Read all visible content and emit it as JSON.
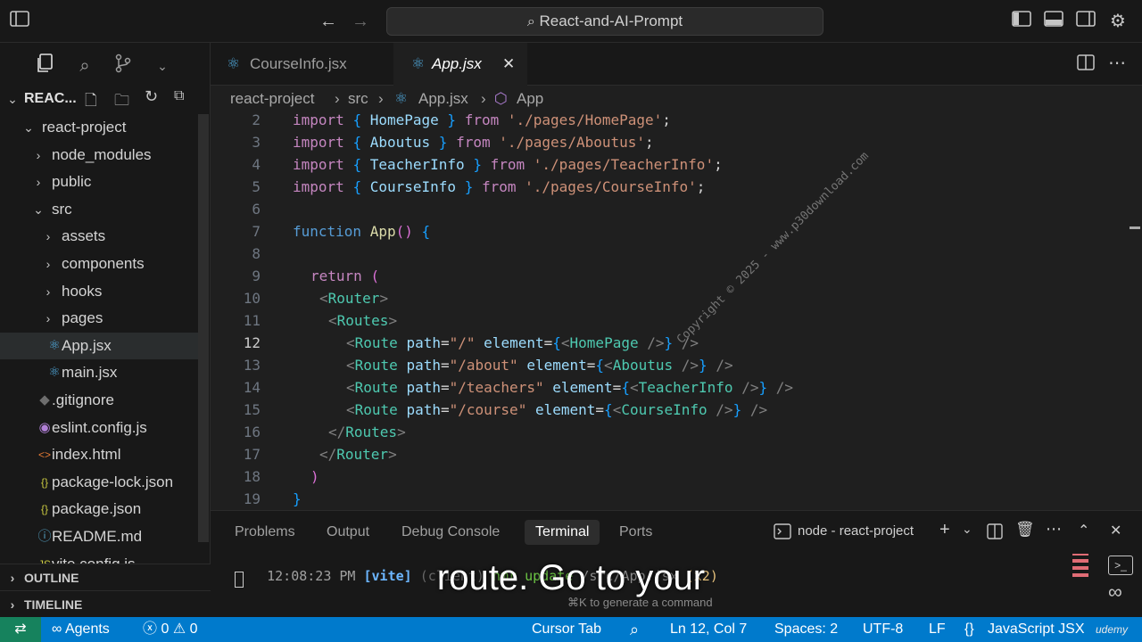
{
  "titlebar": {
    "search_text": "React-and-AI-Prompt"
  },
  "sidebar": {
    "explorer_title": "REAC...",
    "items": [
      {
        "label": "react-project",
        "type": "folder-open",
        "depth": 0
      },
      {
        "label": "node_modules",
        "type": "folder",
        "depth": 1
      },
      {
        "label": "public",
        "type": "folder",
        "depth": 1
      },
      {
        "label": "src",
        "type": "folder-open",
        "depth": 1
      },
      {
        "label": "assets",
        "type": "folder",
        "depth": 2
      },
      {
        "label": "components",
        "type": "folder",
        "depth": 2
      },
      {
        "label": "hooks",
        "type": "folder",
        "depth": 2
      },
      {
        "label": "pages",
        "type": "folder",
        "depth": 2
      },
      {
        "label": "App.jsx",
        "type": "react",
        "depth": 2
      },
      {
        "label": "main.jsx",
        "type": "react",
        "depth": 2
      },
      {
        "label": ".gitignore",
        "type": "git",
        "depth": 1
      },
      {
        "label": "eslint.config.js",
        "type": "eslint",
        "depth": 1
      },
      {
        "label": "index.html",
        "type": "html",
        "depth": 1
      },
      {
        "label": "package-lock.json",
        "type": "json",
        "depth": 1
      },
      {
        "label": "package.json",
        "type": "json",
        "depth": 1
      },
      {
        "label": "README.md",
        "type": "info",
        "depth": 1
      },
      {
        "label": "vite.config.js",
        "type": "js",
        "depth": 1
      }
    ],
    "outline_label": "OUTLINE",
    "timeline_label": "TIMELINE"
  },
  "tabs": [
    {
      "label": "CourseInfo.jsx"
    },
    {
      "label": "App.jsx"
    }
  ],
  "breadcrumb": [
    "react-project",
    "src",
    "App.jsx",
    "App"
  ],
  "editor": {
    "lines": [
      {
        "n": "2",
        "text": "import { HomePage } from './pages/HomePage';"
      },
      {
        "n": "3",
        "text": "import { Aboutus } from './pages/Aboutus';"
      },
      {
        "n": "4",
        "text": "import { TeacherInfo } from './pages/TeacherInfo';"
      },
      {
        "n": "5",
        "text": "import { CourseInfo } from './pages/CourseInfo';"
      },
      {
        "n": "6",
        "text": ""
      },
      {
        "n": "7",
        "text": "function App() {"
      },
      {
        "n": "8",
        "text": ""
      },
      {
        "n": "9",
        "text": "return ("
      },
      {
        "n": "10",
        "text": "<Router>"
      },
      {
        "n": "11",
        "text": "<Routes>"
      },
      {
        "n": "12",
        "text": "<Route path=\"/\" element={<HomePage />} />"
      },
      {
        "n": "13",
        "text": "<Route path=\"/about\" element={<Aboutus />} />"
      },
      {
        "n": "14",
        "text": "<Route path=\"/teachers\" element={<TeacherInfo />} />"
      },
      {
        "n": "15",
        "text": "<Route path=\"/course\" element={<CourseInfo />} />"
      },
      {
        "n": "16",
        "text": "</Routes>"
      },
      {
        "n": "17",
        "text": "</Router>"
      },
      {
        "n": "18",
        "text": ")"
      },
      {
        "n": "19",
        "text": "}"
      }
    ],
    "watermark": "Copyright © 2025 - www.p30download.com"
  },
  "panel": {
    "tabs": [
      "Problems",
      "Output",
      "Debug Console",
      "Terminal",
      "Ports"
    ],
    "active_tab": "Terminal",
    "terminal_name": "node - react-project",
    "terminal_time": "12:08:23 PM",
    "terminal_tag": "[vite]",
    "terminal_client": "(client)",
    "terminal_msg": "hmr update",
    "terminal_path": "/src/App.jsx",
    "terminal_count": "(x2)",
    "hint": "⌘K to generate a command",
    "caption": "route. Go to your"
  },
  "statusbar": {
    "agents": "Agents",
    "errors": "0",
    "warnings": "0",
    "cursor_tab": "Cursor Tab",
    "position": "Ln 12, Col 7",
    "spaces": "Spaces: 2",
    "encoding": "UTF-8",
    "eol": "LF",
    "language": "JavaScript JSX",
    "brand": "udemy"
  },
  "colors": {
    "status_bar": "#007acc",
    "accent_react": "#4fa6d8"
  }
}
